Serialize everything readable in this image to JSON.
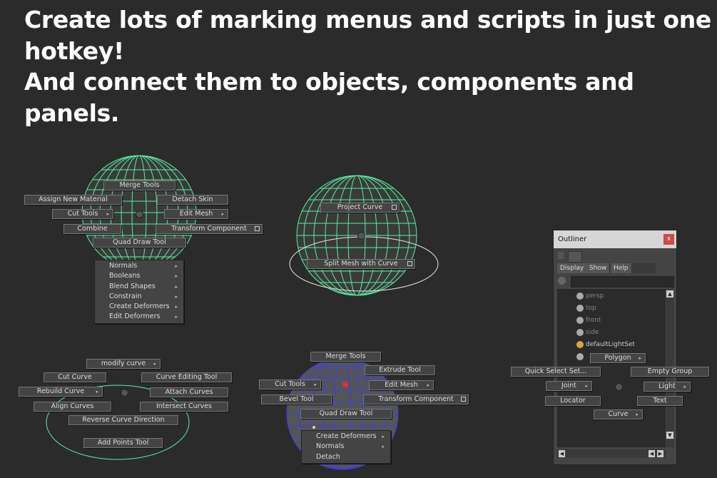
{
  "headline": {
    "line1": "Create lots of marking menus and scripts in just one",
    "line2": "hotkey!",
    "line3": "And connect them to objects, components and",
    "line4": "panels."
  },
  "colors": {
    "background": "#2b2b2b",
    "wireframe_green": "#55f0a0",
    "wireframe_blue": "#3a3aff",
    "menu_bg": "#444444"
  },
  "menu1": {
    "merge_tools": "Merge Tools",
    "assign_new_material": "Assign New Material",
    "detach_skin": "Detach Skin",
    "cut_tools": "Cut Tools",
    "edit_mesh": "Edit Mesh",
    "combine": "Combine",
    "transform_component": "Transform Component",
    "quad_draw_tool": "Quad Draw Tool",
    "submenu": [
      "Normals",
      "Booleans",
      "Blend Shapes",
      "Constrain",
      "Create Deformers",
      "Edit Deformers"
    ]
  },
  "menu2": {
    "project_curve": "Project Curve",
    "split_mesh_with_curve": "Split Mesh with Curve"
  },
  "menu3": {
    "modify_curve": "modify curve",
    "cut_curve": "Cut Curve",
    "curve_editing_tool": "Curve Editing Tool",
    "rebuild_curve": "Rebuild Curve",
    "attach_curves": "Attach Curves",
    "align_curves": "Align Curves",
    "intersect_curves": "Intersect Curves",
    "reverse_curve_direction": "Reverse Curve Direction",
    "add_points_tool": "Add Points Tool"
  },
  "menu4": {
    "merge_tools": "Merge Tools",
    "extrude_tool": "Extrude Tool",
    "cut_tools": "Cut Tools",
    "edit_mesh": "Edit Mesh",
    "bevel_tool": "Bevel Tool",
    "transform_component": "Transform Component",
    "quad_draw_tool": "Quad Draw Tool",
    "submenu": [
      "Create Deformers",
      "Normals",
      "Detach"
    ]
  },
  "outliner": {
    "title": "Outliner",
    "close": "x",
    "menus": [
      "Display",
      "Show",
      "Help"
    ],
    "items": [
      "persp",
      "top",
      "front",
      "side",
      "defaultLightSet"
    ]
  },
  "menu5": {
    "polygon": "Polygon",
    "quick_select_set": "Quick Select Set...",
    "empty_group": "Empty Group",
    "joint": "Joint",
    "light": "Light",
    "locator": "Locator",
    "text": "Text",
    "curve": "Curve"
  }
}
